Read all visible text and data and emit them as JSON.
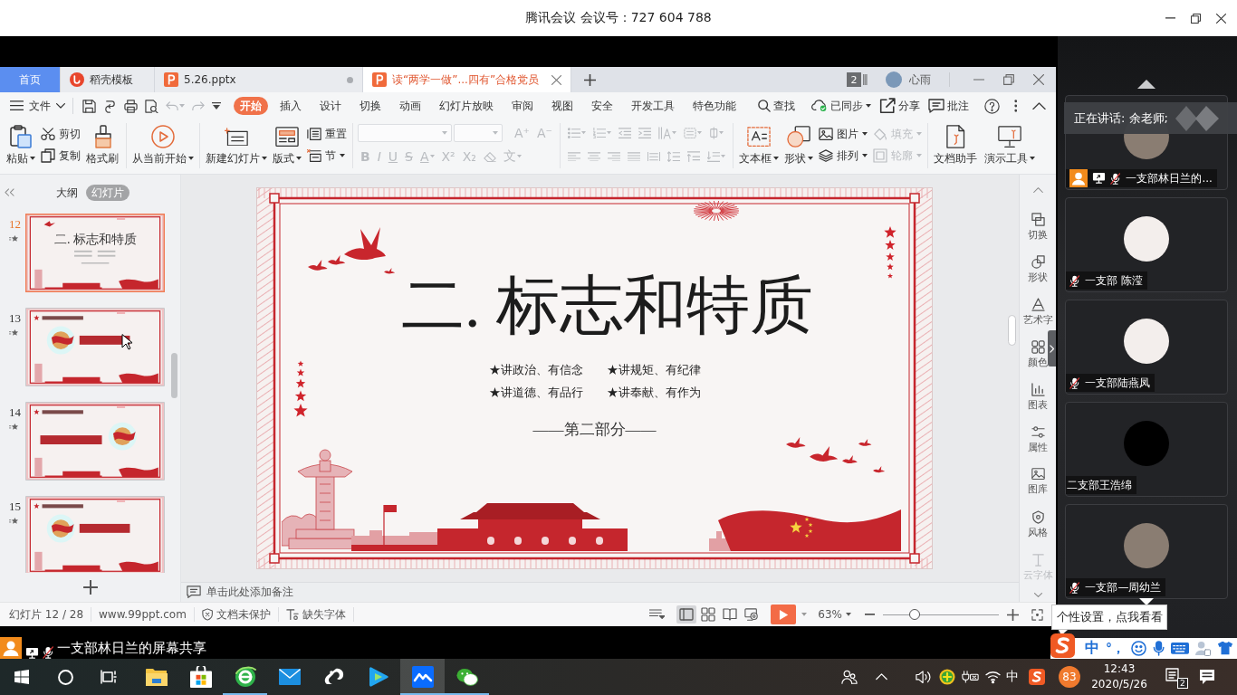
{
  "meeting": {
    "title": "腾讯会议 会议号：727 604 788"
  },
  "wps": {
    "tabs": [
      {
        "kind": "home",
        "label": "首页",
        "selected": false,
        "unsaved": false
      },
      {
        "kind": "template",
        "label": "稻壳模板",
        "selected": false,
        "unsaved": false
      },
      {
        "kind": "document",
        "label": "5.26.pptx",
        "selected": false,
        "unsaved": true
      },
      {
        "kind": "document",
        "label": "读“两学一做”...四有”合格党员",
        "selected": true,
        "unsaved": false
      }
    ],
    "window_count": "2",
    "user": "心雨",
    "menu": {
      "file": "文件",
      "undo": {
        "disabled": true
      },
      "redo": {
        "disabled": true
      },
      "tabs": [
        {
          "label": "开始",
          "selected": true
        },
        {
          "label": "插入",
          "selected": false
        },
        {
          "label": "设计",
          "selected": false
        },
        {
          "label": "切换",
          "selected": false
        },
        {
          "label": "动画",
          "selected": false
        },
        {
          "label": "幻灯片放映",
          "selected": false
        },
        {
          "label": "审阅",
          "selected": false
        },
        {
          "label": "视图",
          "selected": false
        },
        {
          "label": "安全",
          "selected": false
        },
        {
          "label": "开发工具",
          "selected": false
        },
        {
          "label": "特色功能",
          "selected": false
        }
      ],
      "search": "查找",
      "actions": [
        {
          "label": "已同步",
          "dropdown": true
        },
        {
          "label": "分享",
          "dropdown": false
        },
        {
          "label": "批注",
          "dropdown": false
        }
      ]
    },
    "ribbon": [
      {
        "kind": "columns",
        "items": [
          {
            "kind": "large",
            "label": "粘贴",
            "dropdown": true,
            "disabled": false
          },
          {
            "kind": "small",
            "label": "剪切",
            "dropdown": false,
            "disabled": false
          },
          {
            "kind": "small",
            "label": "复制",
            "dropdown": false,
            "disabled": false
          },
          {
            "kind": "large",
            "label": "格式刷",
            "dropdown": false,
            "disabled": false
          }
        ]
      },
      {
        "kind": "columns",
        "items": [
          {
            "kind": "large",
            "label": "从当前开始",
            "dropdown": true,
            "disabled": false
          }
        ]
      },
      {
        "kind": "columns",
        "items": [
          {
            "kind": "large",
            "label": "新建幻灯片",
            "dropdown": true,
            "disabled": false
          },
          {
            "kind": "large",
            "label": "版式",
            "dropdown": true,
            "disabled": false
          },
          {
            "kind": "small",
            "label": "重置",
            "dropdown": false,
            "disabled": false
          },
          {
            "kind": "small",
            "label": "节",
            "dropdown": true,
            "disabled": false
          }
        ]
      },
      {
        "kind": "rows",
        "rows": [
          [
            {
              "kind": "field",
              "dropdown": true,
              "disabled": true
            },
            {
              "kind": "field",
              "dropdown": true,
              "disabled": true
            },
            {
              "kind": "tool",
              "label": "A⁺",
              "dropdown": false,
              "disabled": true
            },
            {
              "kind": "tool",
              "label": "A⁻",
              "dropdown": false,
              "disabled": true
            }
          ],
          [
            {
              "kind": "tool",
              "label": "B",
              "dropdown": false,
              "disabled": true
            },
            {
              "kind": "tool",
              "label": "I",
              "dropdown": false,
              "disabled": true
            },
            {
              "kind": "tool",
              "label": "U",
              "dropdown": false,
              "disabled": true
            },
            {
              "kind": "tool",
              "label": "S",
              "dropdown": false,
              "disabled": true
            },
            {
              "kind": "tool",
              "label": "A",
              "dropdown": true,
              "disabled": true
            },
            {
              "kind": "tool",
              "label": "X²",
              "dropdown": false,
              "disabled": true
            },
            {
              "kind": "tool",
              "label": "X₂",
              "dropdown": false,
              "disabled": true
            },
            {
              "kind": "tool",
              "dropdown": false,
              "disabled": true
            },
            {
              "kind": "tool",
              "label": "文",
              "dropdown": true,
              "disabled": true
            }
          ]
        ]
      },
      {
        "kind": "rows",
        "rows": [
          [
            {
              "kind": "tool",
              "dropdown": true,
              "disabled": true
            },
            {
              "kind": "tool",
              "dropdown": true,
              "disabled": true
            },
            {
              "kind": "tool",
              "dropdown": false,
              "disabled": true
            },
            {
              "kind": "tool",
              "dropdown": false,
              "disabled": true
            },
            {
              "kind": "tool",
              "dropdown": true,
              "disabled": true
            },
            {
              "kind": "tool",
              "dropdown": true,
              "disabled": true
            },
            {
              "kind": "tool",
              "dropdown": true,
              "disabled": true
            }
          ],
          [
            {
              "kind": "tool",
              "dropdown": false,
              "disabled": true
            },
            {
              "kind": "tool",
              "dropdown": false,
              "disabled": true
            },
            {
              "kind": "tool",
              "dropdown": false,
              "disabled": true
            },
            {
              "kind": "tool",
              "dropdown": false,
              "disabled": true
            },
            {
              "kind": "tool",
              "dropdown": false,
              "disabled": true
            },
            {
              "kind": "tool",
              "dropdown": false,
              "disabled": true
            },
            {
              "kind": "tool",
              "dropdown": false,
              "disabled": true
            },
            {
              "kind": "tool",
              "dropdown": true,
              "disabled": true
            }
          ]
        ]
      },
      {
        "kind": "columns",
        "items": [
          {
            "kind": "large",
            "label": "文本框",
            "dropdown": true,
            "disabled": false
          },
          {
            "kind": "large",
            "label": "形状",
            "dropdown": true,
            "disabled": false
          },
          {
            "kind": "small",
            "label": "图片",
            "dropdown": true,
            "disabled": false
          },
          {
            "kind": "small",
            "label": "排列",
            "dropdown": true,
            "disabled": false
          },
          {
            "kind": "small",
            "label": "填充",
            "dropdown": true,
            "disabled": true
          },
          {
            "kind": "small",
            "label": "轮廓",
            "dropdown": true,
            "disabled": true
          }
        ]
      },
      {
        "kind": "columns",
        "items": [
          {
            "kind": "large",
            "label": "文档助手",
            "dropdown": false,
            "disabled": false
          },
          {
            "kind": "large",
            "label": "演示工具",
            "dropdown": true,
            "disabled": false
          }
        ]
      }
    ]
  },
  "slide_panel": {
    "tabs": [
      {
        "label": "大纲",
        "selected": false
      },
      {
        "label": "幻灯片",
        "selected": true
      }
    ],
    "thumbnails": [
      {
        "number": "12",
        "selected": true,
        "kind": "title",
        "title": "二. 标志和特质"
      },
      {
        "number": "13",
        "selected": false,
        "kind": "emblem_left"
      },
      {
        "number": "14",
        "selected": false,
        "kind": "emblem_right"
      },
      {
        "number": "15",
        "selected": false,
        "kind": "emblem_left"
      }
    ]
  },
  "slide": {
    "title": "二. 标志和特质",
    "points": [
      "★讲政治、有信念",
      "★讲规矩、有纪律",
      "★讲道德、有品行",
      "★讲奉献、有作为"
    ],
    "section": "——第二部分——"
  },
  "notes": {
    "placeholder": "单击此处添加备注"
  },
  "side_tools": [
    {
      "label": "切换",
      "disabled": false
    },
    {
      "label": "形状",
      "disabled": false
    },
    {
      "label": "艺术字",
      "disabled": false
    },
    {
      "label": "颜色",
      "disabled": false
    },
    {
      "label": "图表",
      "disabled": false
    },
    {
      "label": "属性",
      "disabled": false
    },
    {
      "label": "图库",
      "disabled": false
    },
    {
      "label": "风格",
      "disabled": false
    },
    {
      "label": "云字体",
      "disabled": true
    }
  ],
  "status_bar": {
    "slide": "幻灯片 12 / 28",
    "website": "www.99ppt.com",
    "protection": "文档未保护",
    "fonts": "缺失字体",
    "views": [
      {
        "selected": true
      },
      {
        "selected": false
      },
      {
        "selected": false
      },
      {
        "selected": false
      }
    ],
    "zoom": "63%",
    "zoom_slider": {
      "level": 0.27
    }
  },
  "participants": {
    "speaking": "正在讲话: 余老师;",
    "people": [
      {
        "name": "一支部林日兰的...",
        "kind": "photo",
        "host": true,
        "sharing": true,
        "muted": true
      },
      {
        "name": "一支部 陈滢",
        "kind": "cartoon",
        "host": false,
        "sharing": false,
        "muted": true
      },
      {
        "name": "一支部陆燕凤",
        "kind": "cartoon",
        "host": false,
        "sharing": false,
        "muted": true
      },
      {
        "name": "二支部王浩绵",
        "kind": "blank",
        "host": false,
        "sharing": false,
        "muted": false
      },
      {
        "name": "一支部—周幼兰",
        "kind": "photo",
        "host": false,
        "sharing": false,
        "muted": true
      }
    ]
  },
  "share_label": {
    "text": "一支部林日兰的屏幕共享",
    "host": true,
    "sharing": true,
    "muted": true
  },
  "tooltip": "个性设置，点我看看",
  "ime": {
    "mode": "中",
    "punctuation": "°，"
  },
  "taskbar": {
    "apps": [
      {
        "running": false,
        "selected": false
      },
      {
        "running": false,
        "selected": false
      },
      {
        "running": true,
        "selected": false
      },
      {
        "running": false,
        "selected": false
      },
      {
        "running": false,
        "selected": false
      },
      {
        "running": false,
        "selected": false
      },
      {
        "running": true,
        "selected": true
      },
      {
        "running": true,
        "selected": false
      }
    ],
    "input_indicator": "中",
    "badge": "83",
    "time": "12:43",
    "date": "2020/5/26",
    "notifications": "2"
  }
}
